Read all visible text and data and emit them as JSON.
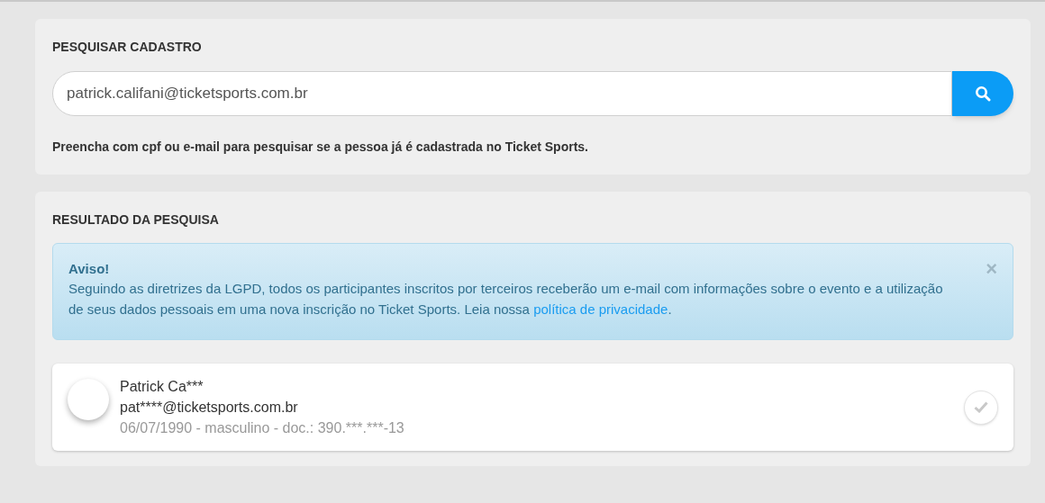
{
  "search_panel": {
    "title": "PESQUISAR CADASTRO",
    "field_value": "patrick.califani@ticketsports.com.br",
    "hint": "Preencha com cpf ou e-mail para pesquisar se a pessoa já é cadastrada no Ticket Sports."
  },
  "results_panel": {
    "title": "RESULTADO DA PESQUISA",
    "alert": {
      "title": "Aviso!",
      "message": "Seguindo as diretrizes da LGPD, todos os participantes inscritos por terceiros receberão um e-mail com informações sobre o evento e a utilização de seus dados pessoais em uma nova inscrição no Ticket Sports. Leia nossa",
      "link": "política de privacidade",
      "suffix": ".",
      "close": "×"
    },
    "results": [
      {
        "name": "Patrick Ca***",
        "email": "pat****@ticketsports.com.br",
        "details": "06/07/1990 - masculino - doc.: 390.***.***-13",
        "selected": false
      }
    ]
  }
}
